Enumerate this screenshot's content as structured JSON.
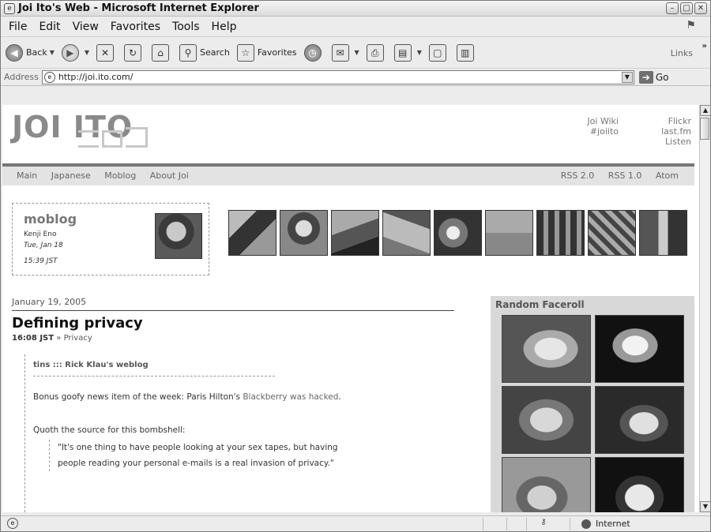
{
  "window": {
    "title": "Joi Ito's Web - Microsoft Internet Explorer"
  },
  "menu": [
    "File",
    "Edit",
    "View",
    "Favorites",
    "Tools",
    "Help"
  ],
  "toolbar": {
    "back": "Back",
    "search": "Search",
    "favorites": "Favorites",
    "links": "Links"
  },
  "address": {
    "label": "Address",
    "url": "http://joi.ito.com/",
    "go": "Go"
  },
  "site": {
    "logo": "JOI ITO",
    "header_links_col1": [
      "Joi Wiki",
      "#joiito"
    ],
    "header_links_col2": [
      "Flickr",
      "last.fm",
      "Listen"
    ],
    "nav_left": [
      "Main",
      "Japanese",
      "Moblog",
      "About Joi"
    ],
    "nav_right": [
      "RSS 2.0",
      "RSS 1.0",
      "Atom"
    ]
  },
  "moblog": {
    "title": "moblog",
    "author": "Kenji Eno",
    "date": "Tue, Jan 18",
    "time": "15:39 JST"
  },
  "post": {
    "date": "January 19, 2005",
    "title": "Defining privacy",
    "time": "16:08 JST",
    "separator": "»",
    "category": "Privacy",
    "source": "tins ::: Rick Klau's weblog",
    "para1_prefix": "Bonus goofy news item of the week: Paris Hilton's ",
    "para1_link": "Blackberry was hacked",
    "para1_suffix": ".",
    "para2": "Quoth the source for this bombshell:",
    "quote_line1": "\"It's one thing to have people looking at your sex tapes, but having",
    "quote_line2": "people reading your personal e-mails is a real invasion of privacy.\""
  },
  "faceroll": {
    "title": "Random Faceroll"
  },
  "status": {
    "zone": "Internet"
  }
}
